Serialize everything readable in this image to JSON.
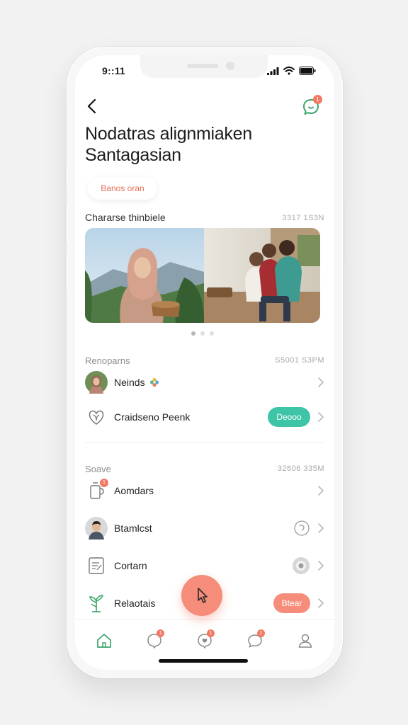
{
  "status_bar": {
    "time": "9::11"
  },
  "header": {
    "title_line1": "Nodatras alignmiaken",
    "title_line2": "Santagasian",
    "chat_badge": "1"
  },
  "chip": {
    "label": "Banos oran"
  },
  "featured": {
    "title": "Chararse thinbiele",
    "meta": "3317 1S3N"
  },
  "section1": {
    "title": "Renoparns",
    "meta": "S5001 S3PM",
    "items": [
      {
        "label": "Neinds",
        "icon": "avatar-woman"
      },
      {
        "label": "Craidseno Peenk",
        "icon": "heart-leaf-icon",
        "badge": "Deooo",
        "badge_color": "#3ec4a6"
      }
    ]
  },
  "section2": {
    "title": "Soave",
    "meta": "32606 335M",
    "items": [
      {
        "label": "Aomdars",
        "icon": "cup-icon",
        "badge_count": "1"
      },
      {
        "label": "Btamlcst",
        "icon": "avatar-man"
      },
      {
        "label": "Cortarn",
        "icon": "document-icon"
      },
      {
        "label": "Relaotais",
        "icon": "plant-icon",
        "badge": "Btear",
        "badge_color": "#f58d7a"
      }
    ]
  },
  "tabbar": {
    "tabs": [
      {
        "name": "home",
        "badge": ""
      },
      {
        "name": "chat",
        "badge": "1"
      },
      {
        "name": "heart-chat",
        "badge": "1"
      },
      {
        "name": "messages",
        "badge": "1"
      },
      {
        "name": "profile",
        "badge": ""
      }
    ]
  },
  "colors": {
    "accent_coral": "#f58d7a",
    "accent_teal": "#3ec4a6",
    "icon_green": "#3aa66b"
  }
}
